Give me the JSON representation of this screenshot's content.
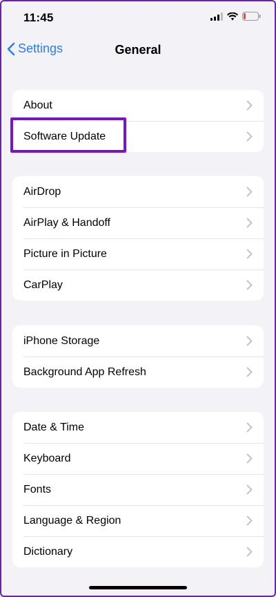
{
  "status_bar": {
    "time": "11:45",
    "battery_level": 0.15,
    "battery_color": "#ff3b30"
  },
  "nav": {
    "back_label": "Settings",
    "title": "General",
    "accent": "#2f7cf6"
  },
  "groups": [
    {
      "items": [
        "About",
        "Software Update"
      ]
    },
    {
      "items": [
        "AirDrop",
        "AirPlay & Handoff",
        "Picture in Picture",
        "CarPlay"
      ]
    },
    {
      "items": [
        "iPhone Storage",
        "Background App Refresh"
      ]
    },
    {
      "items": [
        "Date & Time",
        "Keyboard",
        "Fonts",
        "Language & Region",
        "Dictionary"
      ]
    }
  ],
  "highlight": {
    "item": "Software Update",
    "color": "#7a12c9"
  },
  "icons": {
    "back": "chevron-left-icon",
    "row": "chevron-right-icon",
    "signal": "cellular-signal-icon",
    "wifi": "wifi-icon",
    "battery": "battery-icon"
  }
}
